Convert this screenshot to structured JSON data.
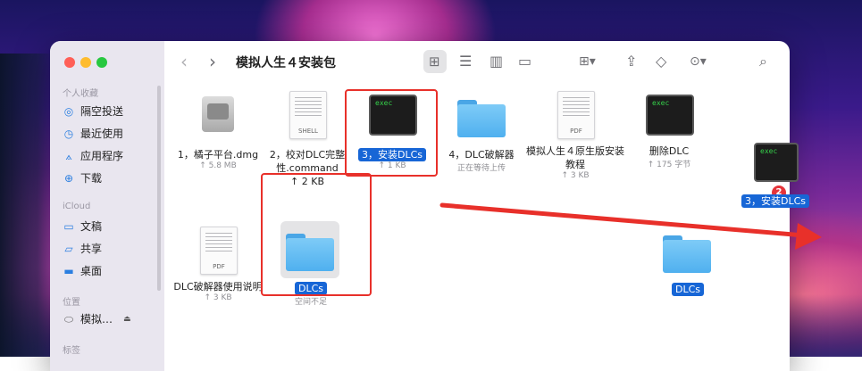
{
  "window": {
    "title": "模拟人生４安装包"
  },
  "sidebar": {
    "sections": [
      {
        "label": "个人收藏",
        "items": [
          {
            "icon": "airdrop-icon",
            "label": "隔空投送"
          },
          {
            "icon": "recents-icon",
            "label": "最近使用"
          },
          {
            "icon": "applications-icon",
            "label": "应用程序"
          },
          {
            "icon": "downloads-icon",
            "label": "下载"
          }
        ]
      },
      {
        "label": "iCloud",
        "items": [
          {
            "icon": "documents-icon",
            "label": "文稿"
          },
          {
            "icon": "shared-folder-icon",
            "label": "共享"
          },
          {
            "icon": "desktop-icon",
            "label": "桌面"
          }
        ]
      },
      {
        "label": "位置",
        "items": [
          {
            "icon": "disk-icon",
            "label": "模拟…"
          }
        ]
      },
      {
        "label": "标签",
        "items": []
      }
    ]
  },
  "files": [
    {
      "name": "1，橘子平台.dmg",
      "sub": "↑ 5.8 MB",
      "kind": "dmg"
    },
    {
      "name": "2，校对DLC完整性.command",
      "sub": "↑ 2 KB",
      "kind": "shell",
      "tag": "SHELL"
    },
    {
      "name": "3，安装DLCs",
      "sub": "↑ 1 KB",
      "kind": "exec",
      "tag": "exec"
    },
    {
      "name": "4，DLC破解器",
      "sub": "正在等待上传",
      "kind": "folder"
    },
    {
      "name": "模拟人生４原生版安装教程",
      "sub": "↑ 3 KB",
      "kind": "pdf",
      "tag": "PDF"
    },
    {
      "name": "删除DLC",
      "sub": "↑ 175 字节",
      "kind": "exec",
      "tag": "exec"
    },
    {
      "name": "DLC破解器使用说明",
      "sub": "↑ 3 KB",
      "kind": "pdf",
      "tag": "PDF"
    },
    {
      "name": "DLCs",
      "sub": "空间不足",
      "kind": "folder"
    }
  ],
  "dragged": {
    "exec_tag": "exec",
    "exec_label": "3，安装DLCs",
    "badge": "2",
    "folder_label": "DLCs"
  },
  "colors": {
    "accent": "#1766d6",
    "annotation": "#e8302a",
    "folder": "#5bb6f0"
  }
}
